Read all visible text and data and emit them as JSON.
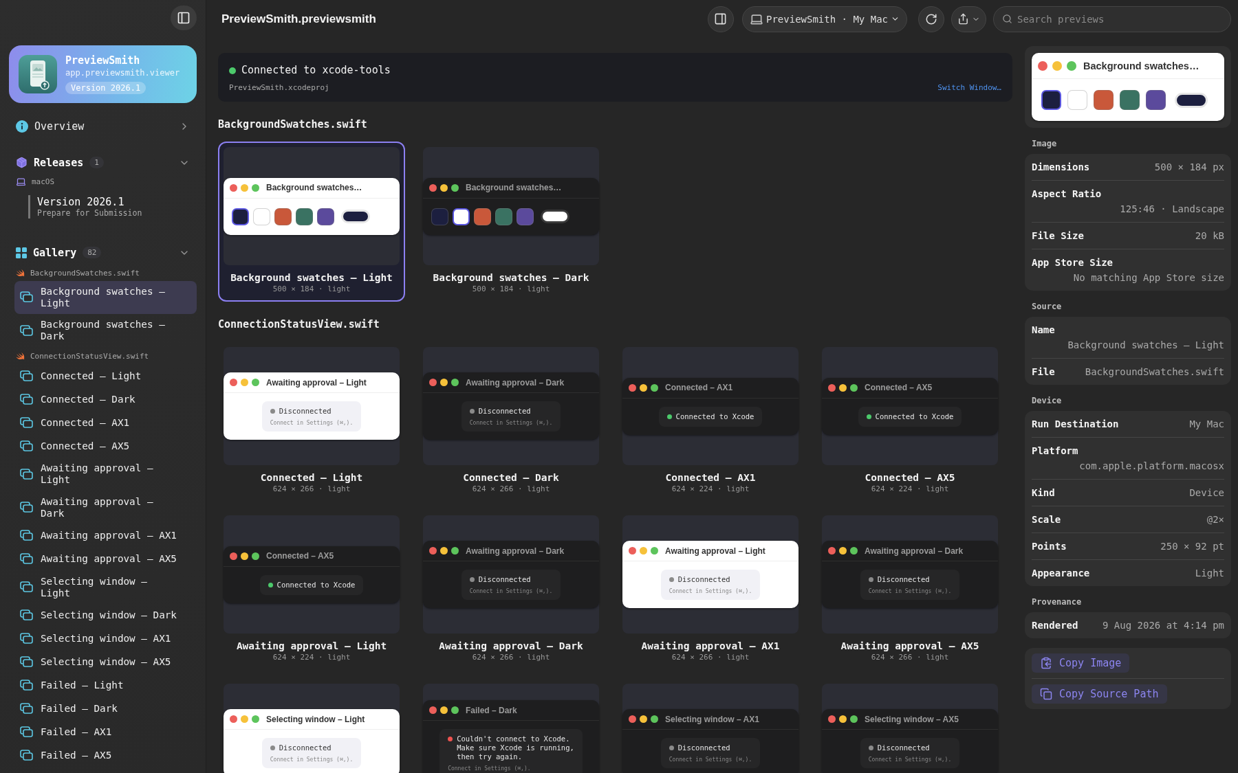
{
  "sidebar": {
    "app": {
      "name": "PreviewSmith",
      "bundle_id": "app.previewsmith.viewer",
      "version": "Version 2026.1"
    },
    "overview": {
      "label": "Overview"
    },
    "releases": {
      "label": "Releases",
      "count": "1",
      "expanded": true,
      "platform": "macOS",
      "version": {
        "title": "Version 2026.1",
        "status": "Prepare for Submission"
      }
    },
    "gallery": {
      "label": "Gallery",
      "count": "82",
      "expanded": true,
      "groups": [
        {
          "file": "BackgroundSwatches.swift",
          "items": [
            {
              "label": "Background swatches — Light",
              "selected": true
            },
            {
              "label": "Background swatches — Dark",
              "selected": false
            }
          ]
        },
        {
          "file": "ConnectionStatusView.swift",
          "items": [
            {
              "label": "Connected — Light",
              "selected": false
            },
            {
              "label": "Connected — Dark",
              "selected": false
            },
            {
              "label": "Connected — AX1",
              "selected": false
            },
            {
              "label": "Connected — AX5",
              "selected": false
            },
            {
              "label": "Awaiting approval — Light",
              "selected": false
            },
            {
              "label": "Awaiting approval — Dark",
              "selected": false
            },
            {
              "label": "Awaiting approval — AX1",
              "selected": false
            },
            {
              "label": "Awaiting approval — AX5",
              "selected": false
            },
            {
              "label": "Selecting window — Light",
              "selected": false
            },
            {
              "label": "Selecting window — Dark",
              "selected": false
            },
            {
              "label": "Selecting window — AX1",
              "selected": false
            },
            {
              "label": "Selecting window — AX5",
              "selected": false
            },
            {
              "label": "Failed — Light",
              "selected": false
            },
            {
              "label": "Failed — Dark",
              "selected": false
            },
            {
              "label": "Failed — AX1",
              "selected": false
            },
            {
              "label": "Failed — AX5",
              "selected": false
            }
          ]
        }
      ]
    }
  },
  "toolbar": {
    "title": "PreviewSmith.previewsmith",
    "destination": "PreviewSmith · My Mac",
    "search": {
      "placeholder": "Search previews"
    }
  },
  "connection": {
    "status": "Connected to xcode-tools",
    "project": "PreviewSmith.xcodeproj",
    "action": "Switch Window…"
  },
  "sections": [
    {
      "title": "BackgroundSwatches.swift",
      "previews": [
        {
          "kind": "swatches",
          "dark": false,
          "window_title": "Background swatches…",
          "selected": true,
          "title": "Background swatches — Light",
          "meta": "500 × 184 · light",
          "swatches": [
            {
              "kind": "square",
              "color": "#1c1f3f",
              "selected": true
            },
            {
              "kind": "square",
              "color": "#ffffff",
              "selected": false
            },
            {
              "kind": "square",
              "color": "#c9583a",
              "selected": false
            },
            {
              "kind": "square",
              "color": "#3a7262",
              "selected": false
            },
            {
              "kind": "square",
              "color": "#5b4a9c",
              "selected": false
            },
            {
              "kind": "pill",
              "color": "#1c1f3f",
              "selected": false
            }
          ]
        },
        {
          "kind": "swatches",
          "dark": true,
          "window_title": "Background swatches…",
          "selected": false,
          "title": "Background swatches — Dark",
          "meta": "500 × 184 · light",
          "swatches": [
            {
              "kind": "square",
              "color": "#1c1f3f",
              "selected": false
            },
            {
              "kind": "square",
              "color": "#ffffff",
              "selected": true
            },
            {
              "kind": "square",
              "color": "#c9583a",
              "selected": false
            },
            {
              "kind": "square",
              "color": "#3a7262",
              "selected": false
            },
            {
              "kind": "square",
              "color": "#5b4a9c",
              "selected": false
            },
            {
              "kind": "pill",
              "color": "#ffffff",
              "selected": false
            }
          ]
        }
      ]
    },
    {
      "title": "ConnectionStatusView.swift",
      "previews": [
        {
          "kind": "status",
          "dark": false,
          "window_title": "Awaiting approval – Light",
          "color": "#8a8a8a",
          "message": "Disconnected",
          "hint": "Connect in Settings (⌘,).",
          "selected": false,
          "title": "Connected — Light",
          "meta": "624 × 266 · light"
        },
        {
          "kind": "status",
          "dark": true,
          "window_title": "Awaiting approval – Dark",
          "color": "#8a8a8a",
          "message": "Disconnected",
          "hint": "Connect in Settings (⌘,).",
          "selected": false,
          "title": "Connected — Dark",
          "meta": "624 × 266 · light"
        },
        {
          "kind": "status",
          "dark": true,
          "window_title": "Connected – AX1",
          "color": "#4cc96b",
          "message": "Connected to Xcode",
          "selected": false,
          "title": "Connected — AX1",
          "meta": "624 × 224 · light"
        },
        {
          "kind": "status",
          "dark": true,
          "window_title": "Connected – AX5",
          "color": "#4cc96b",
          "message": "Connected to Xcode",
          "selected": false,
          "title": "Connected — AX5",
          "meta": "624 × 224 · light"
        },
        {
          "kind": "status",
          "dark": true,
          "window_title": "Connected – AX5",
          "color": "#4cc96b",
          "message": "Connected to Xcode",
          "selected": false,
          "title": "Awaiting approval — Light",
          "meta": "624 × 224 · light"
        },
        {
          "kind": "status",
          "dark": true,
          "window_title": "Awaiting approval – Dark",
          "color": "#8a8a8a",
          "message": "Disconnected",
          "hint": "Connect in Settings (⌘,).",
          "selected": false,
          "title": "Awaiting approval — Dark",
          "meta": "624 × 266 · light"
        },
        {
          "kind": "status",
          "dark": false,
          "window_title": "Awaiting approval – Light",
          "color": "#8a8a8a",
          "message": "Disconnected",
          "hint": "Connect in Settings (⌘,).",
          "selected": false,
          "title": "Awaiting approval — AX1",
          "meta": "624 × 266 · light"
        },
        {
          "kind": "status",
          "dark": true,
          "window_title": "Awaiting approval – Dark",
          "color": "#8a8a8a",
          "message": "Disconnected",
          "hint": "Connect in Settings (⌘,).",
          "selected": false,
          "title": "Awaiting approval — AX5",
          "meta": "624 × 266 · light"
        },
        {
          "kind": "status",
          "dark": false,
          "window_title": "Selecting window – Light",
          "color": "#8a8a8a",
          "message": "Disconnected",
          "hint": "Connect in Settings (⌘,).",
          "selected": false
        },
        {
          "kind": "status",
          "dark": true,
          "wrap": true,
          "window_title": "Failed – Dark",
          "color": "#ef5350",
          "message": "Couldn't connect to Xcode. Make sure Xcode is running, then try again.",
          "hint": "Connect in Settings (⌘,).",
          "selected": false
        },
        {
          "kind": "status",
          "dark": true,
          "window_title": "Selecting window – AX1",
          "color": "#8a8a8a",
          "message": "Disconnected",
          "hint": "Connect in Settings (⌘,).",
          "selected": false
        },
        {
          "kind": "status",
          "dark": true,
          "window_title": "Selecting window – AX5",
          "color": "#8a8a8a",
          "message": "Disconnected",
          "hint": "Connect in Settings (⌘,).",
          "selected": false
        }
      ]
    }
  ],
  "inspector": {
    "preview": {
      "dark": false,
      "window_title": "Background swatches…",
      "swatches": [
        {
          "kind": "square",
          "color": "#1c1f3f",
          "selected": true
        },
        {
          "kind": "square",
          "color": "#ffffff",
          "selected": false
        },
        {
          "kind": "square",
          "color": "#c9583a",
          "selected": false
        },
        {
          "kind": "square",
          "color": "#3a7262",
          "selected": false
        },
        {
          "kind": "square",
          "color": "#5b4a9c",
          "selected": false
        },
        {
          "kind": "pill",
          "color": "#1c1f3f",
          "selected": false
        }
      ]
    },
    "sections": [
      {
        "title": "Image",
        "rows": [
          {
            "kind": "inline",
            "label": "Dimensions",
            "value": "500 × 184 px"
          },
          {
            "kind": "stacked",
            "label": "Aspect Ratio",
            "value": "125:46 · Landscape"
          },
          {
            "kind": "inline",
            "label": "File Size",
            "value": "20 kB"
          },
          {
            "kind": "stacked",
            "label": "App Store Size",
            "value": "No matching App Store size"
          }
        ]
      },
      {
        "title": "Source",
        "rows": [
          {
            "kind": "stacked",
            "label": "Name",
            "value": "Background swatches — Light"
          },
          {
            "kind": "inline",
            "label": "File",
            "value": "BackgroundSwatches.swift"
          }
        ]
      },
      {
        "title": "Device",
        "rows": [
          {
            "kind": "inline",
            "label": "Run Destination",
            "value": "My Mac"
          },
          {
            "kind": "stacked",
            "label": "Platform",
            "value": "com.apple.platform.macosx"
          },
          {
            "kind": "inline",
            "label": "Kind",
            "value": "Device"
          },
          {
            "kind": "inline",
            "label": "Scale",
            "value": "@2×"
          },
          {
            "kind": "inline",
            "label": "Points",
            "value": "250 × 92 pt"
          },
          {
            "kind": "inline",
            "label": "Appearance",
            "value": "Light"
          }
        ]
      },
      {
        "title": "Provenance",
        "rows": [
          {
            "kind": "inline",
            "label": "Rendered",
            "value": "9 Aug 2026 at 4:14 pm"
          }
        ]
      }
    ],
    "actions": [
      {
        "kind": "image",
        "label": "Copy Image"
      },
      {
        "kind": "path",
        "label": "Copy Source Path"
      }
    ]
  }
}
